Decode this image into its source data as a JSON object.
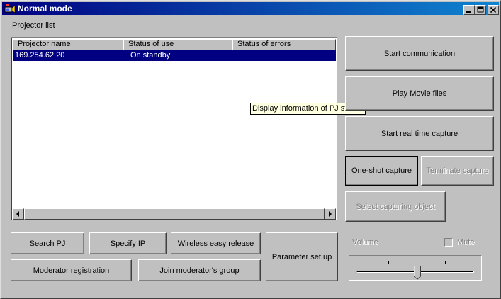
{
  "window": {
    "title": "Normal mode"
  },
  "projector_list": {
    "label": "Projector list",
    "columns": [
      "Projector name",
      "Status of use",
      "Status of errors"
    ],
    "rows": [
      {
        "name": "169.254.62.20",
        "status_of_use": "On standby",
        "status_of_errors": ""
      }
    ]
  },
  "tooltip": "Display information of PJ status.",
  "right_buttons": {
    "start_communication": "Start communication",
    "play_movie_files": "Play Movie files",
    "start_real_time_capture": "Start real time capture",
    "one_shot_capture": "One-shot capture",
    "terminate_capture": "Terminate capture",
    "select_capturing_object": "Select capturing object"
  },
  "bottom_buttons": {
    "search_pj": "Search PJ",
    "specify_ip": "Specify IP",
    "wireless_easy_release": "Wireless easy release",
    "moderator_registration": "Moderator registration",
    "join_moderators_group": "Join moderator's group",
    "parameter_set_up": "Parameter set up"
  },
  "volume": {
    "label": "Volume",
    "mute_label": "Mute",
    "mute_checked": false,
    "level": 0.55
  },
  "colors": {
    "title_bar": "#000080",
    "selection": "#000080",
    "face": "#c0c0c0",
    "tooltip_bg": "#ffffe1"
  }
}
